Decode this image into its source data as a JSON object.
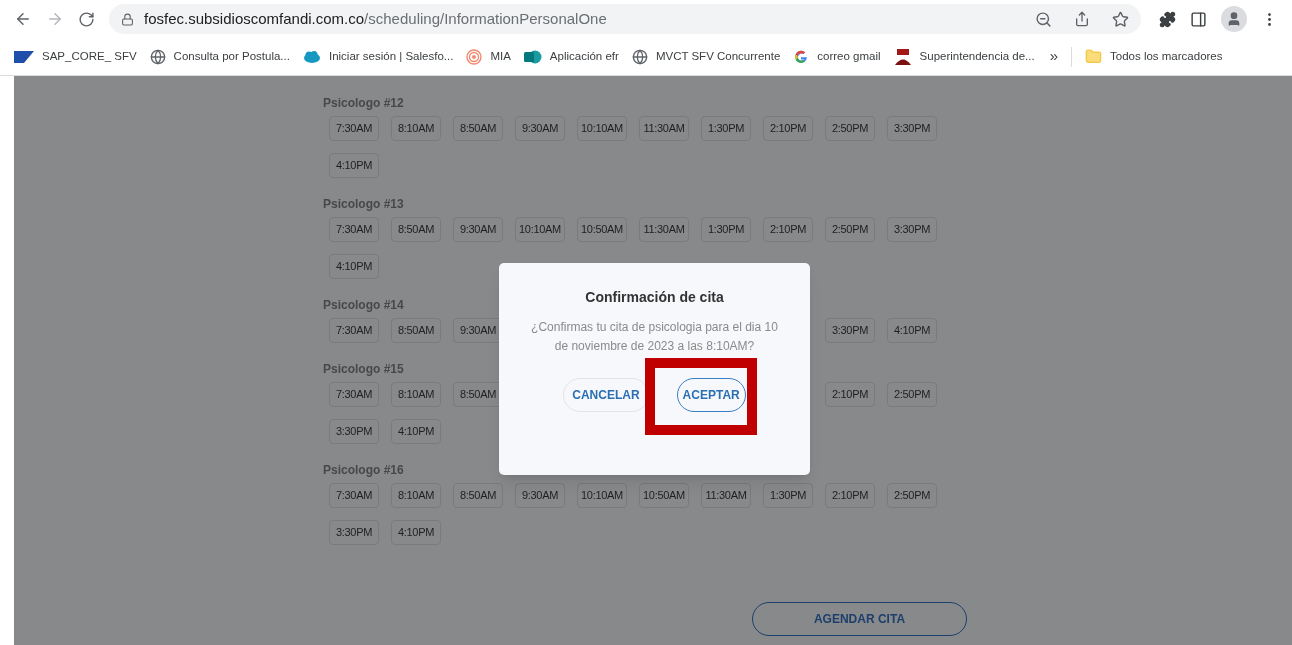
{
  "browser": {
    "url_host": "fosfec.subsidioscomfandi.com.co",
    "url_path": "/scheduling/InformationPersonalOne",
    "bookmarks": [
      {
        "kind": "sap",
        "label": "SAP_CORE_ SFV"
      },
      {
        "kind": "globe",
        "label": "Consulta por Postula..."
      },
      {
        "kind": "cloud",
        "label": "Iniciar sesión | Salesfo..."
      },
      {
        "kind": "target",
        "label": "MIA"
      },
      {
        "kind": "sharepoint",
        "label": "Aplicación efr"
      },
      {
        "kind": "globe",
        "label": "MVCT SFV Concurrente"
      },
      {
        "kind": "google",
        "label": "correo gmail"
      },
      {
        "kind": "emblem",
        "label": "Superintendencia de..."
      }
    ],
    "overflow": "»",
    "all_bookmarks": "Todos los marcadores"
  },
  "psychologists": [
    {
      "name": "Psicologo #12",
      "slots": [
        "7:30AM",
        "8:10AM",
        "8:50AM",
        "9:30AM",
        "10:10AM",
        "11:30AM",
        "1:30PM",
        "2:10PM",
        "2:50PM",
        "3:30PM",
        "4:10PM"
      ]
    },
    {
      "name": "Psicologo #13",
      "slots": [
        "7:30AM",
        "8:50AM",
        "9:30AM",
        "10:10AM",
        "10:50AM",
        "11:30AM",
        "1:30PM",
        "2:10PM",
        "2:50PM",
        "3:30PM",
        "4:10PM"
      ]
    },
    {
      "name": "Psicologo #14",
      "slots": [
        "7:30AM",
        "8:50AM",
        "9:30AM"
      ],
      "slots_after_dialog": [
        "3:30PM",
        "4:10PM"
      ]
    },
    {
      "name": "Psicologo #15",
      "slots": [
        "7:30AM",
        "8:10AM",
        "8:50AM"
      ],
      "slots_after_dialog": [
        "2:10PM",
        "2:50PM",
        "3:30PM",
        "4:10PM"
      ]
    },
    {
      "name": "Psicologo #16",
      "slots": [
        "7:30AM",
        "8:10AM",
        "8:50AM",
        "9:30AM",
        "10:10AM",
        "10:50AM",
        "11:30AM",
        "1:30PM",
        "2:10PM",
        "2:50PM",
        "3:30PM",
        "4:10PM"
      ]
    }
  ],
  "submit_button": "AGENDAR CITA",
  "dialog": {
    "title": "Confirmación de cita",
    "message": "¿Confirmas tu cita de psicologia para el dia 10 de noviembre de 2023 a las 8:10AM?",
    "cancel": "CANCELAR",
    "accept": "ACEPTAR",
    "accept_highlighted": true
  }
}
